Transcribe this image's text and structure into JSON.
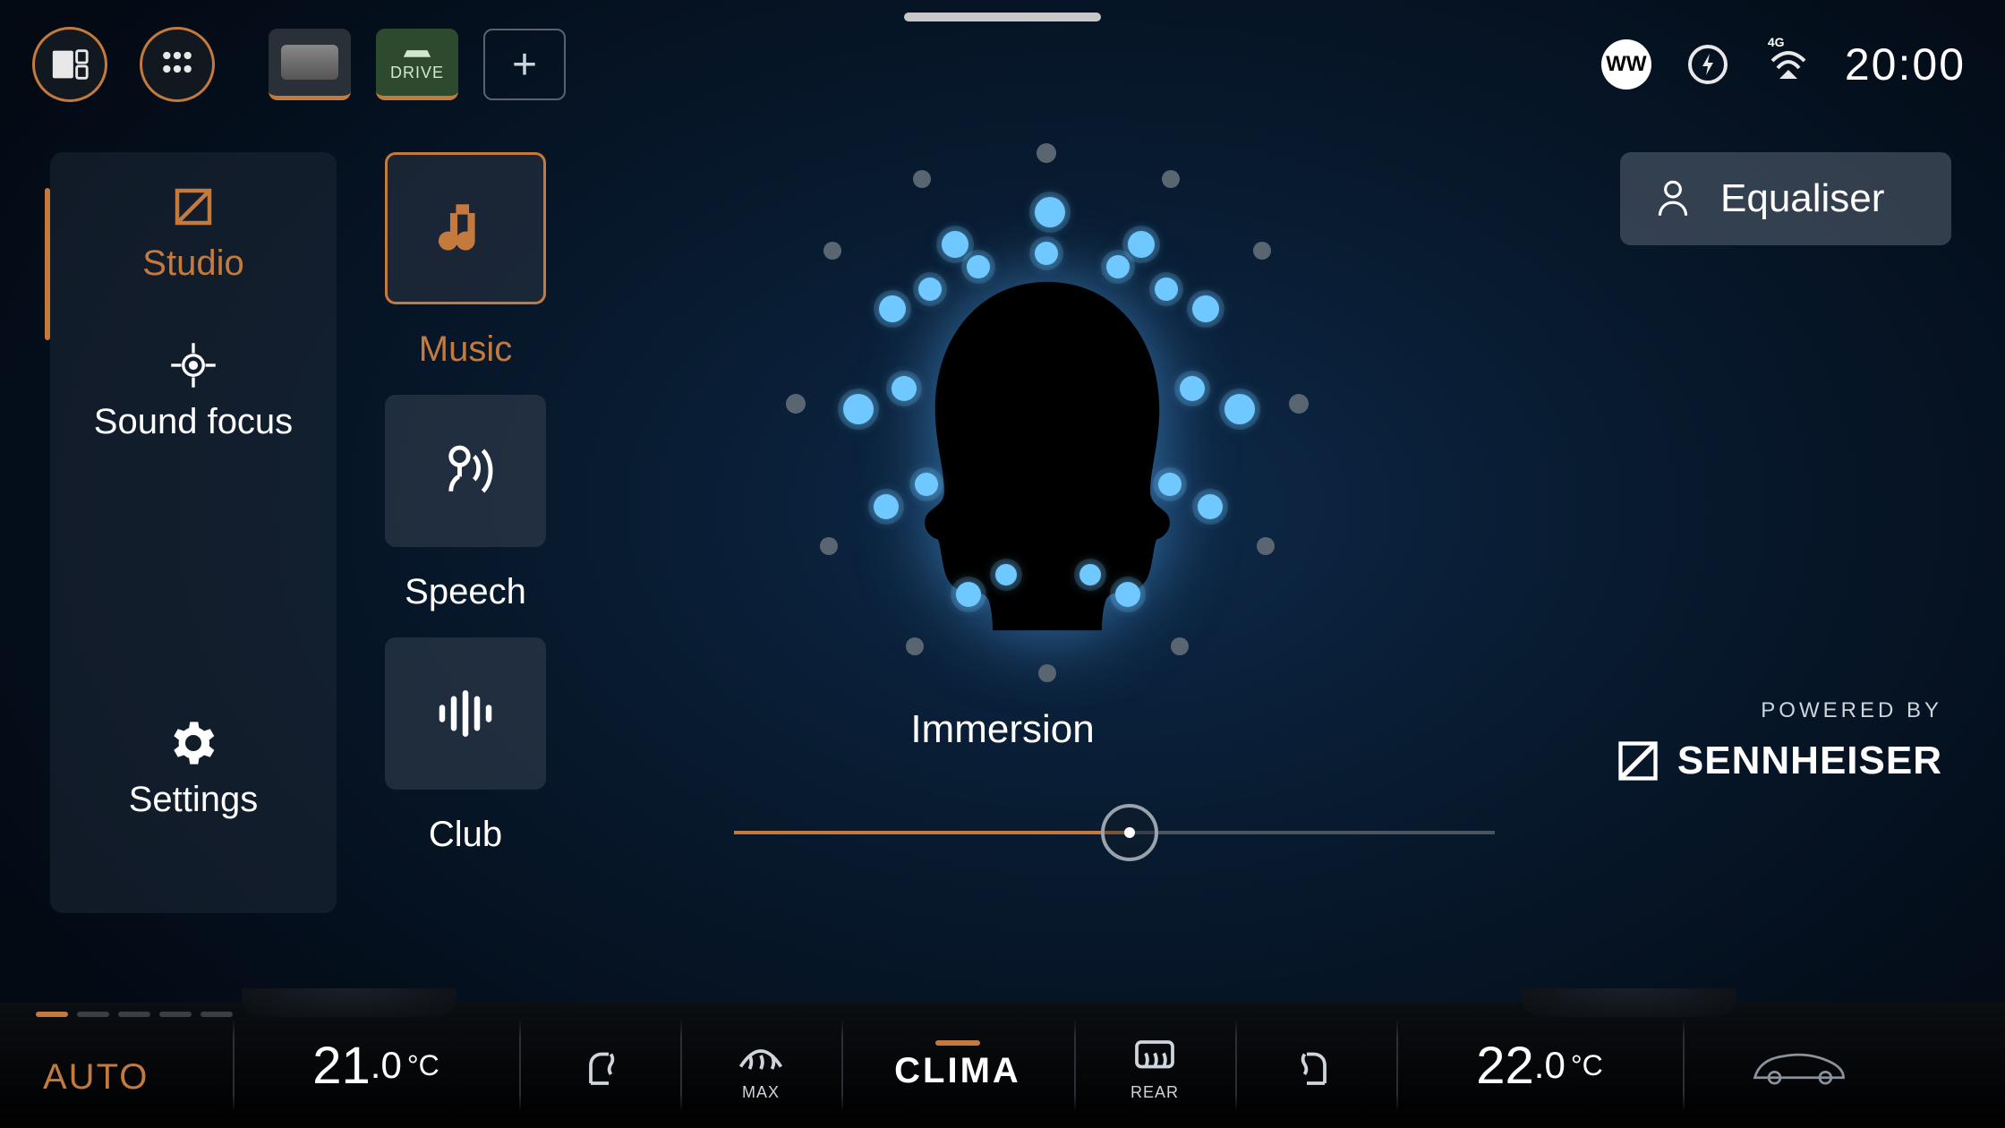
{
  "topbar": {
    "drive_label": "DRIVE",
    "ww_badge": "WW",
    "network_label": "4G",
    "clock": "20:00"
  },
  "sidebar": {
    "studio": "Studio",
    "sound_focus": "Sound focus",
    "settings": "Settings"
  },
  "modes": {
    "music": "Music",
    "speech": "Speech",
    "club": "Club"
  },
  "centre": {
    "immersion_label": "Immersion",
    "slider_value_pct": 52
  },
  "right": {
    "equaliser": "Equaliser",
    "powered_by": "POWERED BY",
    "brand": "SENNHEISER"
  },
  "bottombar": {
    "auto": "AUTO",
    "temp_left_int": "21",
    "temp_left_dec": ".0",
    "temp_left_unit": "°C",
    "defrost_max": "MAX",
    "clima": "CLIMA",
    "defrost_rear": "REAR",
    "temp_right_int": "22",
    "temp_right_dec": ".0",
    "temp_right_unit": "°C"
  }
}
